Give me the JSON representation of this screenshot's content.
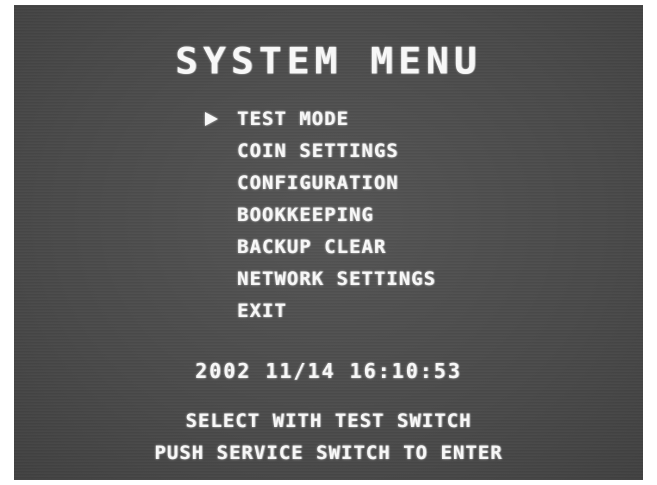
{
  "screen": {
    "title": "SYSTEM MENU",
    "menu": {
      "selected_index": 0,
      "cursor_icon": "triangle-right",
      "items": [
        {
          "label": "TEST MODE"
        },
        {
          "label": "COIN SETTINGS"
        },
        {
          "label": "CONFIGURATION"
        },
        {
          "label": "BOOKKEEPING"
        },
        {
          "label": "BACKUP CLEAR"
        },
        {
          "label": "NETWORK SETTINGS"
        },
        {
          "label": "EXIT"
        }
      ]
    },
    "datetime": "2002 11/14 16:10:53",
    "instructions": {
      "line1": "SELECT WITH TEST SWITCH",
      "line2": "PUSH SERVICE SWITCH TO ENTER"
    }
  },
  "colors": {
    "screen_background": "#4a4a4a",
    "text": "#f7f7f7",
    "page_background": "#ffffff"
  }
}
